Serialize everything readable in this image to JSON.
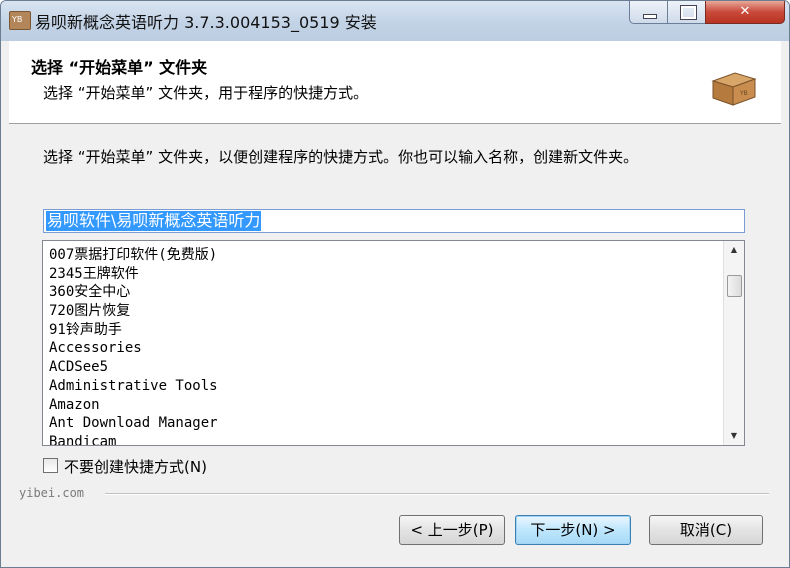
{
  "window": {
    "title": "易呗新概念英语听力 3.7.3.004153_0519 安装",
    "app_icon_text": "YB"
  },
  "header": {
    "title": "选择 “开始菜单” 文件夹",
    "subtitle": "选择 “开始菜单” 文件夹，用于程序的快捷方式。"
  },
  "body": {
    "description": "选择 “开始菜单” 文件夹，以便创建程序的快捷方式。你也可以输入名称，创建新文件夹。",
    "folder_value": "易呗软件\\易呗新概念英语听力",
    "list_items": [
      "007票据打印软件(免费版)",
      "2345王牌软件",
      "360安全中心",
      "720图片恢复",
      "91铃声助手",
      "Accessories",
      "ACDSee5",
      "Administrative Tools",
      "Amazon",
      "Ant Download Manager",
      "Bandicam"
    ],
    "no_shortcut_label": "不要创建快捷方式(N)",
    "brand": "yibei.com"
  },
  "buttons": {
    "back": "< 上一步(P)",
    "next": "下一步(N) >",
    "cancel": "取消(C)"
  },
  "colors": {
    "selection": "#3399ff",
    "default_button": "#3c7fb1",
    "close_button": "#c8493a"
  }
}
